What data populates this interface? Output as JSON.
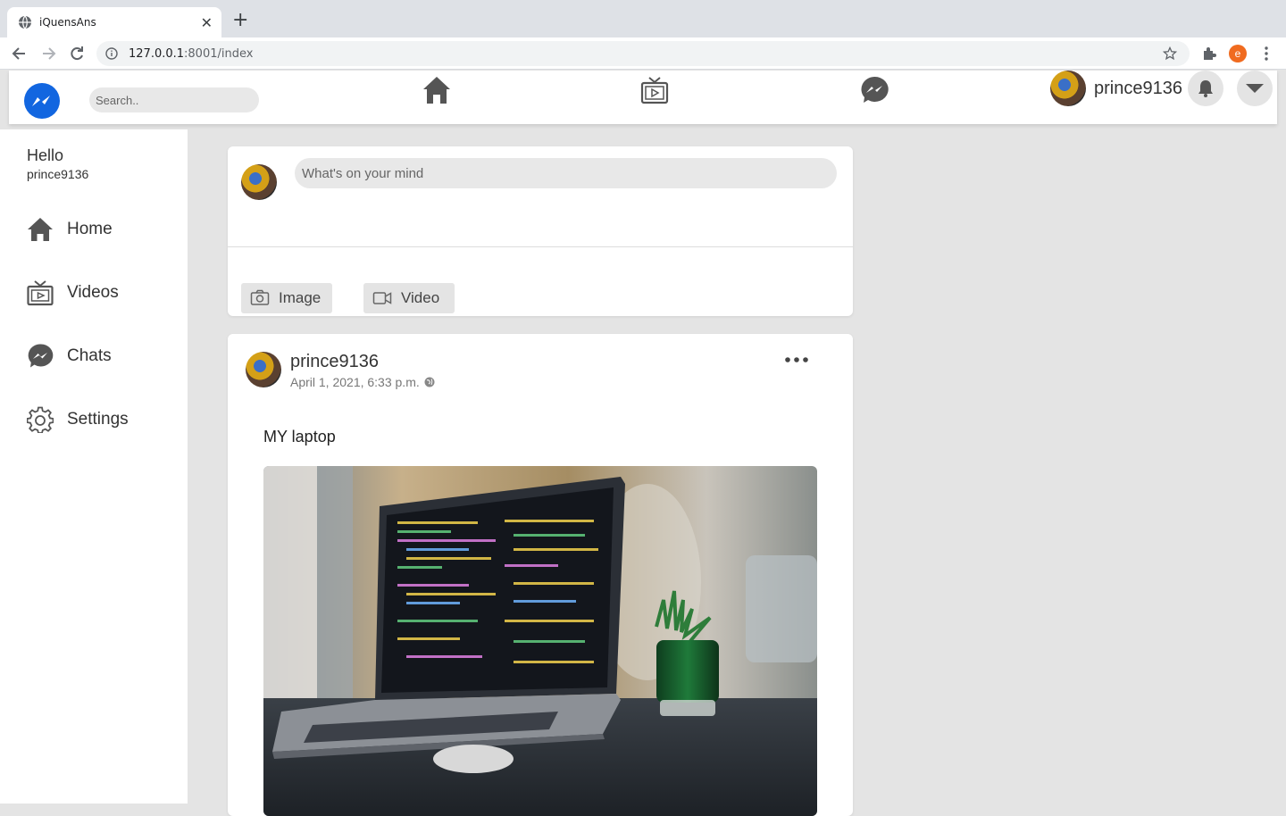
{
  "browser": {
    "tab_title": "iQuensAns",
    "url_host": "127.0.0.1",
    "url_rest": ":8001/index",
    "profile_initial": "e"
  },
  "header": {
    "search_placeholder": "Search..",
    "username": "prince9136",
    "nav_icons": [
      "home-icon",
      "tv-icon",
      "messenger-icon"
    ],
    "brand_color": "#1877f2"
  },
  "sidebar": {
    "greeting": "Hello",
    "username": "prince9136",
    "items": [
      {
        "label": "Home",
        "icon": "home-icon"
      },
      {
        "label": "Videos",
        "icon": "tv-icon"
      },
      {
        "label": "Chats",
        "icon": "messenger-icon"
      },
      {
        "label": "Settings",
        "icon": "gear-icon"
      }
    ]
  },
  "composer": {
    "placeholder": "What's on your mind",
    "image_label": "Image",
    "video_label": "Video"
  },
  "post": {
    "author": "prince9136",
    "timestamp": "April 1, 2021, 6:33 p.m.",
    "text": "MY laptop"
  }
}
